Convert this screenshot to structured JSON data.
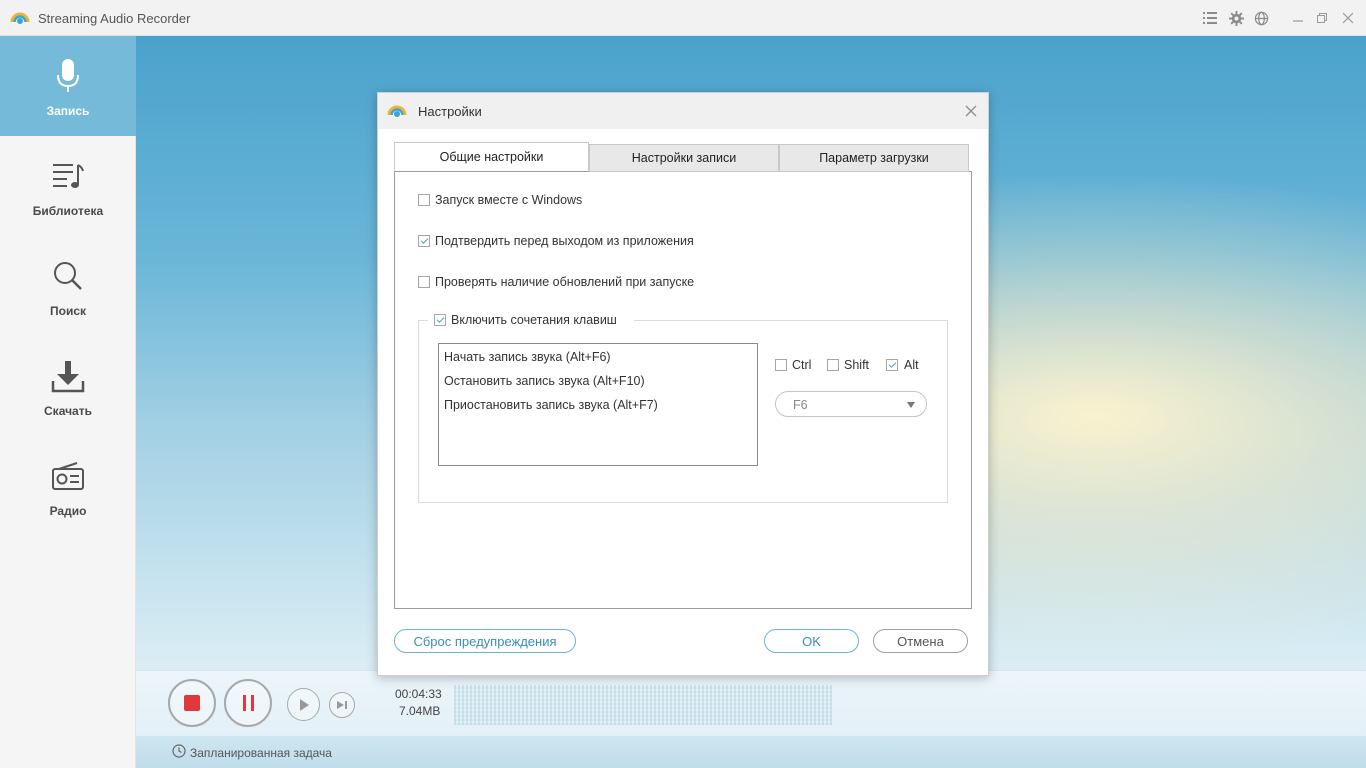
{
  "app": {
    "title": "Streaming Audio Recorder"
  },
  "titlebar": {
    "icons": [
      "list-icon",
      "gear-icon",
      "globe-icon",
      "minimize-icon",
      "restore-icon",
      "close-icon"
    ]
  },
  "sidebar": {
    "items": [
      {
        "label": "Запись",
        "icon": "microphone-icon",
        "active": true
      },
      {
        "label": "Библиотека",
        "icon": "music-list-icon",
        "active": false
      },
      {
        "label": "Поиск",
        "icon": "search-icon",
        "active": false
      },
      {
        "label": "Скачать",
        "icon": "download-icon",
        "active": false
      },
      {
        "label": "Радио",
        "icon": "radio-icon",
        "active": false
      }
    ]
  },
  "player": {
    "time": "00:04:33",
    "size": "7.04MB",
    "scheduler_label": "Запланированная задача"
  },
  "dialog": {
    "title": "Настройки",
    "tabs": [
      {
        "label": "Общие настройки",
        "active": true
      },
      {
        "label": "Настройки записи",
        "active": false
      },
      {
        "label": "Параметр загрузки",
        "active": false
      }
    ],
    "options": [
      {
        "label": "Запуск вместе с Windows",
        "checked": false
      },
      {
        "label": "Подтвердить перед выходом из приложения",
        "checked": true
      },
      {
        "label": "Проверять наличие обновлений при запуске",
        "checked": false
      }
    ],
    "hotkeys": {
      "label": "Включить сочетания клавиш",
      "enabled": true,
      "items": [
        "Начать запись звука (Alt+F6)",
        "Остановить запись звука (Alt+F10)",
        "Приостановить запись звука (Alt+F7)"
      ],
      "modifiers": [
        {
          "label": "Ctrl",
          "checked": false
        },
        {
          "label": "Shift",
          "checked": false
        },
        {
          "label": "Alt",
          "checked": true
        }
      ],
      "key": "F6"
    },
    "buttons": {
      "reset": "Сброс предупреждения",
      "ok": "OK",
      "cancel": "Отмена"
    }
  },
  "colors": {
    "accent": "#75bbd9",
    "record": "#e0383b",
    "button_border": "#6fb3d3"
  }
}
